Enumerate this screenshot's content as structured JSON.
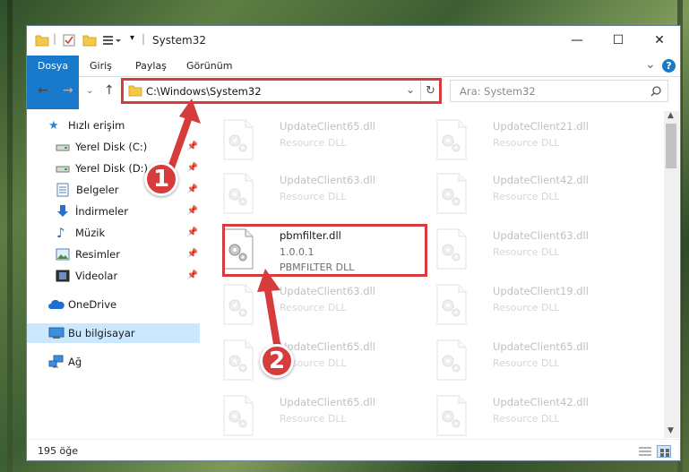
{
  "window": {
    "title": "System32",
    "minimize": "—",
    "maximize": "☐",
    "close": "✕"
  },
  "ribbon": {
    "tabs": [
      "Dosya",
      "Giriş",
      "Paylaş",
      "Görünüm"
    ],
    "expand_icon": "⌄",
    "help_icon": "?"
  },
  "address": {
    "path": "C:\\Windows\\System32",
    "search_placeholder": "Ara: System32"
  },
  "sidebar": {
    "items": [
      {
        "label": "Hızlı erişim",
        "icon": "star-icon"
      },
      {
        "label": "Yerel Disk (C:)",
        "icon": "drive-icon",
        "pinned": true
      },
      {
        "label": "Yerel Disk (D:)",
        "icon": "drive-icon",
        "pinned": true
      },
      {
        "label": "Belgeler",
        "icon": "document-icon",
        "pinned": true
      },
      {
        "label": "İndirmeler",
        "icon": "download-icon",
        "pinned": true
      },
      {
        "label": "Müzik",
        "icon": "music-icon",
        "pinned": true
      },
      {
        "label": "Resimler",
        "icon": "pictures-icon",
        "pinned": true
      },
      {
        "label": "Videolar",
        "icon": "videos-icon",
        "pinned": true
      },
      {
        "label": "OneDrive",
        "icon": "onedrive-icon"
      },
      {
        "label": "Bu bilgisayar",
        "icon": "computer-icon",
        "selected": true
      },
      {
        "label": "Ağ",
        "icon": "network-icon"
      }
    ]
  },
  "files": [
    {
      "name": "UpdateClient65.dll",
      "desc": "Resource DLL"
    },
    {
      "name": "UpdateClient21.dll",
      "desc": "Resource DLL"
    },
    {
      "name": "UpdateClient63.dll",
      "desc": "Resource DLL"
    },
    {
      "name": "UpdateClient42.dll",
      "desc": "Resource DLL"
    },
    {
      "name": "pbmfilter.dll",
      "desc": "1.0.0.1",
      "desc2": "PBMFILTER DLL"
    },
    {
      "name": "UpdateClient63.dll",
      "desc": "Resource DLL"
    },
    {
      "name": "UpdateClient63.dll",
      "desc": "Resource DLL"
    },
    {
      "name": "UpdateClient19.dll",
      "desc": "Resource DLL"
    },
    {
      "name": "UpdateClient65.dll",
      "desc": "Resource DLL"
    },
    {
      "name": "UpdateClient65.dll",
      "desc": "Resource DLL"
    },
    {
      "name": "UpdateClient65.dll",
      "desc": "Resource DLL"
    },
    {
      "name": "UpdateClient42.dll",
      "desc": "Resource DLL"
    }
  ],
  "status": {
    "count": "195 öğe"
  },
  "callouts": [
    "1",
    "2"
  ],
  "colors": {
    "accent": "#1979ca",
    "highlight": "#d63c3c",
    "selected": "#cce8ff"
  }
}
